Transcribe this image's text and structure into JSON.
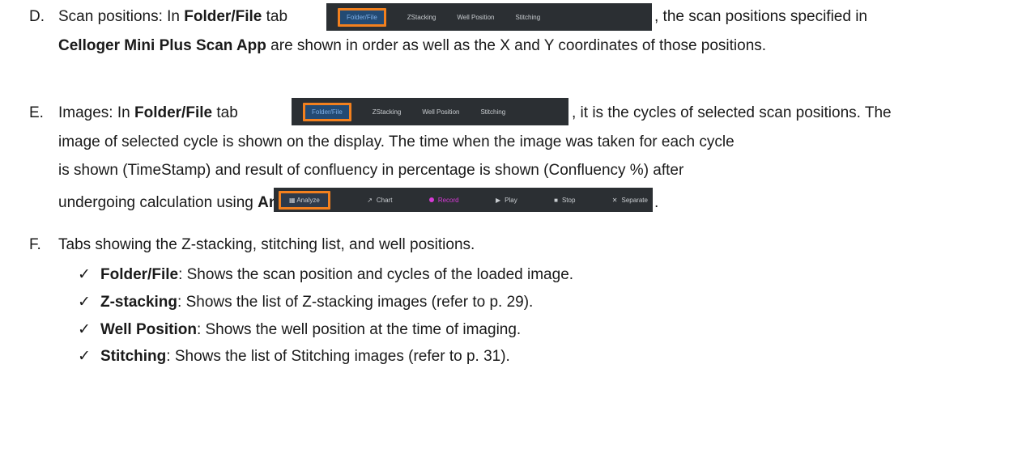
{
  "itemD": {
    "letter": "D.",
    "p1_pre": "Scan positions: In ",
    "p1_bold": "Folder/File",
    "p1_post": " tab",
    "p1_tail": ", the scan positions specified in",
    "p2_bold": "Celloger Mini Plus Scan App",
    "p2_post": " are shown in order as well as the X and Y coordinates of those positions."
  },
  "itemE": {
    "letter": "E.",
    "p1_pre": "Images: In ",
    "p1_bold": "Folder/File",
    "p1_post": " tab",
    "p1_tail": ", it is the cycles of selected scan positions. The",
    "line2": "image of selected cycle is shown on the display. The time when the image was taken for each cycle",
    "line3": "is shown (TimeStamp) and result of confluency in percentage is shown (Confluency %) after",
    "line4_pre": "undergoing calculation using ",
    "line4_bold": "Analyze",
    "line4_tail": "."
  },
  "itemF": {
    "letter": "F.",
    "text": "Tabs showing the Z-stacking, stitching list, and well positions.",
    "check_glyph": "✓",
    "bullets": [
      {
        "bold": "Folder/File",
        "rest": ": Shows the scan position and cycles of the loaded image."
      },
      {
        "bold": "Z-stacking",
        "rest": ": Shows the list of Z-stacking images (refer to p. 29)."
      },
      {
        "bold": "Well Position",
        "rest": ": Shows the well position at the time of imaging."
      },
      {
        "bold": "Stitching",
        "rest": ": Shows the list of Stitching images (refer to p. 31)."
      }
    ]
  },
  "tab_toolbar": {
    "tabs": [
      "Folder/File",
      "ZStacking",
      "Well Position",
      "Stitching"
    ],
    "highlight_color": "#f2801e"
  },
  "analyze_toolbar": {
    "buttons": [
      "Analyze",
      "Chart",
      "Record",
      "Play",
      "Stop",
      "Separate"
    ],
    "record_color": "#d63ad6"
  }
}
